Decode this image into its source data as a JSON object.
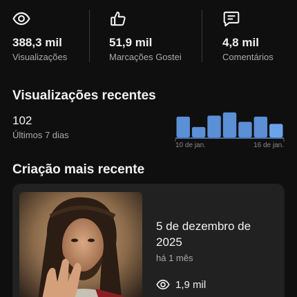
{
  "stats": [
    {
      "icon": "eye-icon",
      "value": "388,3 mil",
      "label": "Visualizações"
    },
    {
      "icon": "thumbs-up-icon",
      "value": "51,9 mil",
      "label": "Marcações Gostei"
    },
    {
      "icon": "comment-icon",
      "value": "4,8 mil",
      "label": "Comentários"
    }
  ],
  "recent_views": {
    "title": "Visualizações recentes",
    "count": "102",
    "period": "Últimos 7 dias"
  },
  "chart_data": {
    "type": "bar",
    "categories": [
      "",
      "",
      "",
      "",
      "",
      "",
      ""
    ],
    "values": [
      20,
      10,
      21,
      24,
      15,
      20,
      13
    ],
    "tick_labels": [
      "10 de jan.",
      "16 de jan."
    ],
    "color": "#5b8fd6",
    "highlight_color": "#6aa3ea"
  },
  "latest_creation": {
    "title": "Criação mais recente",
    "date": "5 de dezembro de 2025",
    "ago": "há 1 mês",
    "views": "1,9 mil",
    "views_icon": "eye-icon"
  }
}
